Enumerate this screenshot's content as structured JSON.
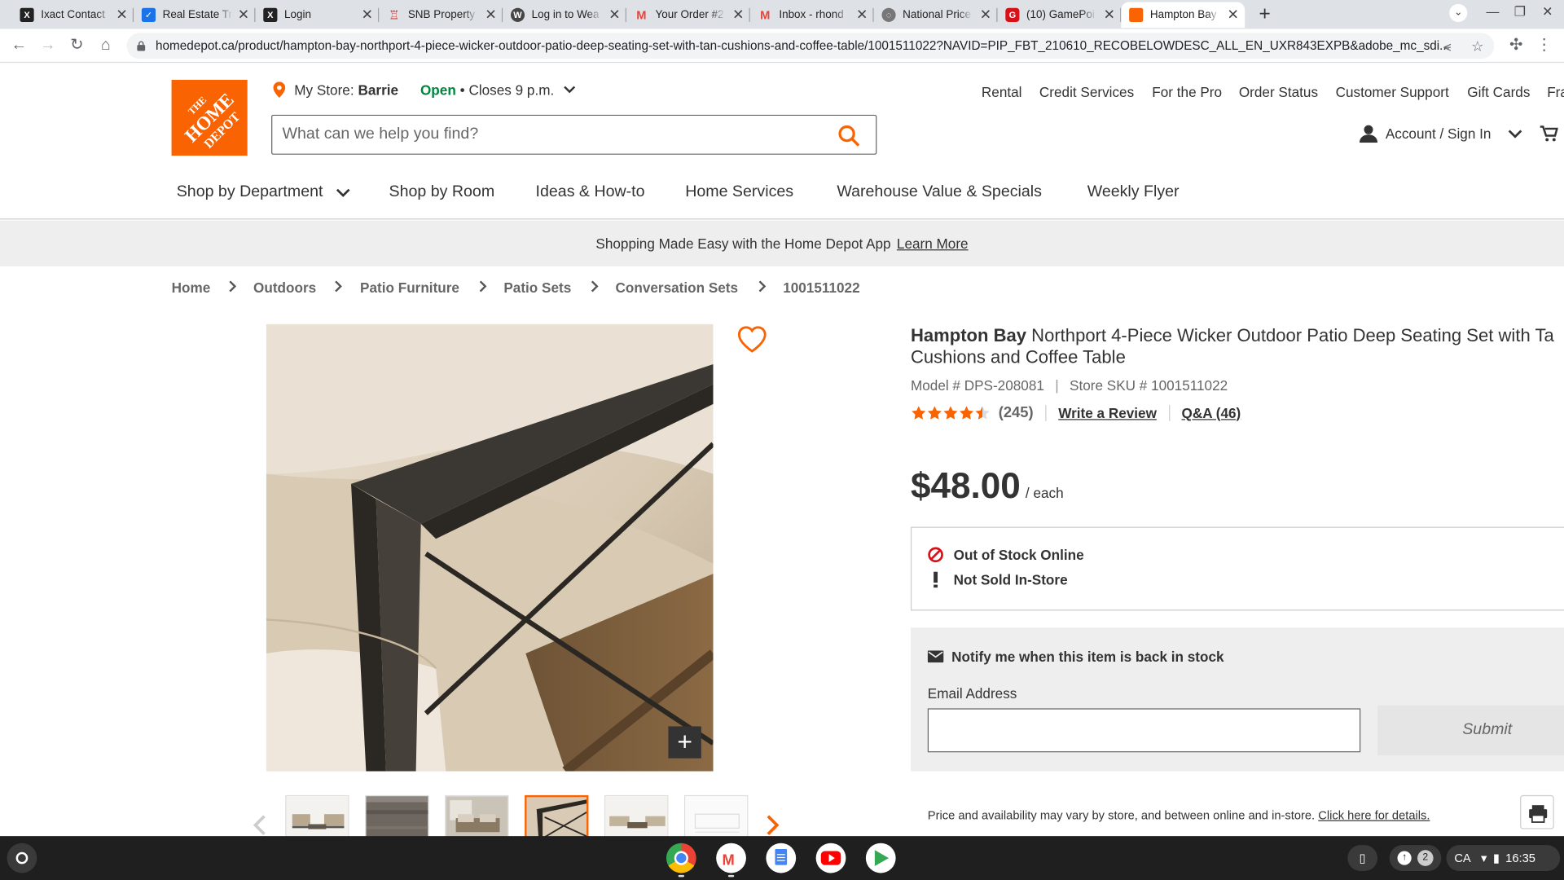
{
  "browser": {
    "tabs": [
      {
        "title": "Ixact Contact",
        "icon": "x-icon"
      },
      {
        "title": "Real Estate Tr",
        "icon": "checkbox-icon"
      },
      {
        "title": "Login",
        "icon": "x-icon"
      },
      {
        "title": "SNB Property",
        "icon": "snb-icon"
      },
      {
        "title": "Log in to Wea",
        "icon": "wordpress-icon"
      },
      {
        "title": "Your Order #2",
        "icon": "gmail-icon"
      },
      {
        "title": "Inbox - rhond",
        "icon": "gmail-icon"
      },
      {
        "title": "National Price",
        "icon": "globe-icon"
      },
      {
        "title": "(10) GamePoi",
        "icon": "gamepoint-icon"
      },
      {
        "title": "Hampton Bay",
        "icon": "homedepot-icon"
      }
    ],
    "url": "homedepot.ca/product/hampton-bay-northport-4-piece-wicker-outdoor-patio-deep-seating-set-with-tan-cushions-and-coffee-table/1001511022?NAVID=PIP_FBT_210610_RECOBELOWDESC_ALL_EN_UXR843EXPB&adobe_mc_sdi..."
  },
  "header": {
    "store_prefix": "My Store:",
    "store_name": "Barrie",
    "open_status": "Open",
    "closes": "• Closes 9 p.m.",
    "util_links": [
      "Rental",
      "Credit Services",
      "For the Pro",
      "Order Status",
      "Customer Support",
      "Gift Cards",
      "Fra"
    ],
    "search_placeholder": "What can we help you find?",
    "account_label": "Account / Sign In"
  },
  "nav": {
    "items": [
      "Shop by Department",
      "Shop by Room",
      "Ideas & How-to",
      "Home Services",
      "Warehouse Value & Specials",
      "Weekly Flyer"
    ]
  },
  "promo": {
    "text": "Shopping Made Easy with the Home Depot App",
    "link": "Learn More"
  },
  "breadcrumbs": [
    "Home",
    "Outdoors",
    "Patio Furniture",
    "Patio Sets",
    "Conversation Sets",
    "1001511022"
  ],
  "product": {
    "brand": "Hampton Bay",
    "title": "Northport 4-Piece Wicker Outdoor Patio Deep Seating Set with Ta",
    "title_line2": "Cushions and Coffee Table",
    "model": "Model # DPS-208081",
    "sku": "Store SKU # 1001511022",
    "rating": 4.5,
    "review_count": "(245)",
    "write_review": "Write a Review",
    "qa": "Q&A (46)",
    "price": "$48.00",
    "price_unit": "/ each",
    "stock_online": "Out of Stock Online",
    "stock_store": "Not Sold In-Store",
    "zoom_label": "+"
  },
  "notify": {
    "heading": "Notify me when this item is back in stock",
    "email_label": "Email Address",
    "email_value": "",
    "submit": "Submit"
  },
  "disclaimer": {
    "text": "Price and availability may vary by store, and between online and in-store.",
    "link": "Click here for details."
  },
  "system": {
    "locale": "CA",
    "notifications": "2",
    "time": "16:35"
  },
  "colors": {
    "brand_orange": "#f96302",
    "open_green": "#00853e",
    "stock_red": "#d81118"
  }
}
